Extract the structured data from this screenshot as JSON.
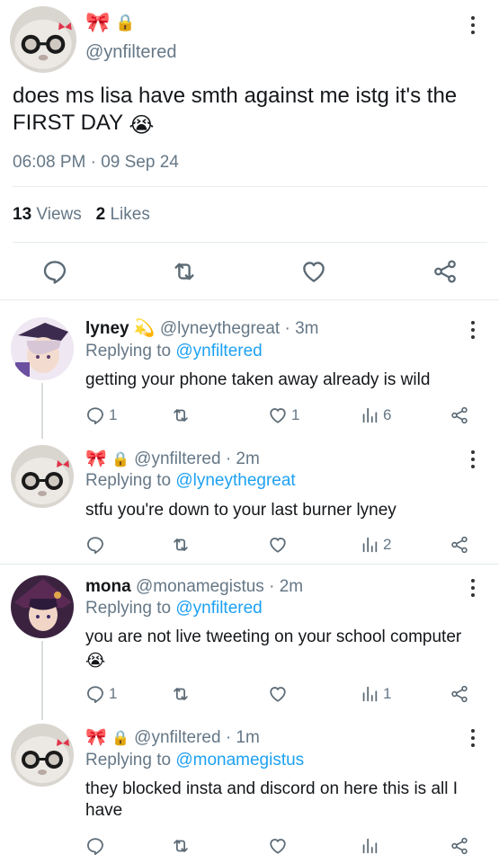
{
  "main": {
    "badges": [
      "🎀",
      "🔒"
    ],
    "handle": "@ynfiltered",
    "text": "does ms lisa have smth against me istg it's the FIRST DAY",
    "text_emoji": "😭",
    "time": "06:08 PM · 09 Sep 24",
    "views_count": "13",
    "views_label": "Views",
    "likes_count": "2",
    "likes_label": "Likes"
  },
  "replies": [
    {
      "name": "lyney",
      "name_emoji": "💫",
      "handle": "@lyneythegreat",
      "time": "· 3m",
      "replying_prefix": "Replying to",
      "replying_to": "@ynfiltered",
      "text": "getting your phone taken away already is wild",
      "reply_count": "1",
      "like_count": "1",
      "view_count": "6"
    },
    {
      "badges": [
        "🎀",
        "🔒"
      ],
      "handle": "@ynfiltered",
      "time": "· 2m",
      "replying_prefix": "Replying to",
      "replying_to": "@lyneythegreat",
      "text": "stfu you're down to your last burner lyney",
      "view_count": "2"
    },
    {
      "name": "mona",
      "handle": "@monamegistus",
      "time": "· 2m",
      "replying_prefix": "Replying to",
      "replying_to": "@ynfiltered",
      "text": "you are not live tweeting on your school computer",
      "text_emoji": "😭",
      "reply_count": "1",
      "view_count": "1"
    },
    {
      "badges": [
        "🎀",
        "🔒"
      ],
      "handle": "@ynfiltered",
      "time": "· 1m",
      "replying_prefix": "Replying to",
      "replying_to": "@monamegistus",
      "text": "they blocked insta and discord on here this is all I have"
    }
  ],
  "icons": {
    "reply": "reply-icon",
    "retweet": "retweet-icon",
    "like": "heart-icon",
    "views": "views-icon",
    "share": "share-icon",
    "more": "more-vertical-icon"
  },
  "colors": {
    "link": "#1da1f2",
    "secondary_text": "#657786",
    "icon": "#5b6a75"
  }
}
